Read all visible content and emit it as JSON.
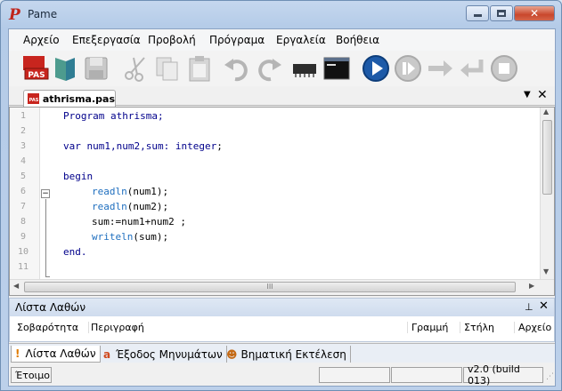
{
  "window": {
    "title": "Pame",
    "app_icon_letter": "P"
  },
  "menu": [
    "Αρχείο",
    "Επεξεργασία",
    "Προβολή",
    "Πρόγραμα",
    "Εργαλεία",
    "Βοήθεια"
  ],
  "toolbar": {
    "new_badge": "PAS"
  },
  "doc_tab": {
    "label": "athrisma.pas",
    "badge": "PAS"
  },
  "editor": {
    "line_numbers": [
      "1",
      "2",
      "3",
      "4",
      "5",
      "6",
      "7",
      "8",
      "9",
      "10",
      "11"
    ],
    "lines": {
      "l1": "Program athrisma;",
      "l3a": "var num1,num2,sum: ",
      "l3b": "integer",
      "l3c": ";",
      "l5": "begin",
      "l6a": "readln",
      "l6b": "(num1);",
      "l7a": "readln",
      "l7b": "(num2);",
      "l8": "sum:=num1+num2 ;",
      "l9a": "writeln",
      "l9b": "(sum);",
      "l10": "end."
    },
    "scroll_grip": "III"
  },
  "error_panel": {
    "title": "Λίστα Λαθών",
    "columns": {
      "severity": "Σοβαρότητα",
      "description": "Περιγραφή",
      "line": "Γραμμή",
      "column": "Στήλη",
      "file": "Αρχείο"
    }
  },
  "bottom_tabs": [
    {
      "label": "Λίστα Λαθών",
      "icon": "!"
    },
    {
      "label": "Έξοδος Μηνυμάτων",
      "icon": "a"
    },
    {
      "label": "Βηματική Εκτέλεση",
      "icon": "☻"
    }
  ],
  "status": {
    "state": "Έτοιμο",
    "version": "v2.0 (build 013)"
  }
}
